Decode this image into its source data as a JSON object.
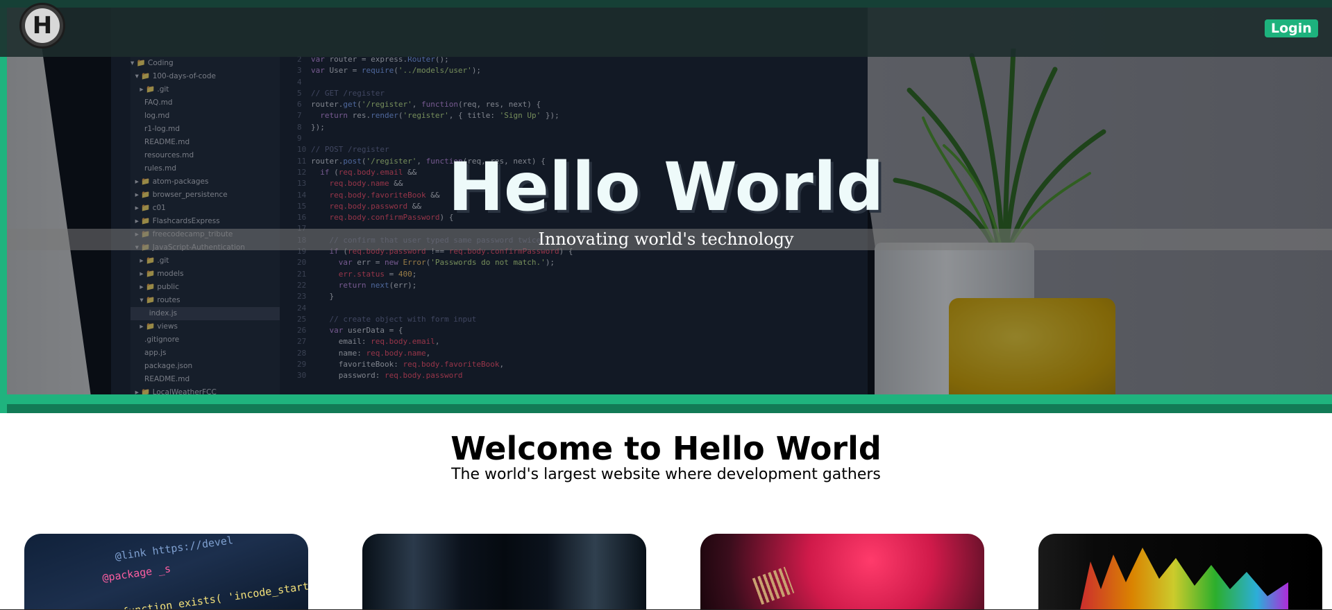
{
  "navbar": {
    "logo_letter": "H",
    "login_label": "Login"
  },
  "hero": {
    "title": "Hello World",
    "subtitle": "Innovating world's technology"
  },
  "welcome": {
    "title": "Welcome to Hello World",
    "subtitle": "The world's largest website where development gathers"
  },
  "cards": [
    {
      "image": "code-editor-photo",
      "code_text_1": "@link https://devel",
      "code_text_2": "@package _s",
      "code_text_3": "function_exists( 'incode_starter_se"
    },
    {
      "image": "server-room-photo"
    },
    {
      "image": "circuit-board-photo"
    },
    {
      "image": "audio-spectrum-photo"
    }
  ],
  "colors": {
    "accent": "#1db27d",
    "accent_dark": "#127a56",
    "navbar_bg": "#1c2c2c"
  }
}
